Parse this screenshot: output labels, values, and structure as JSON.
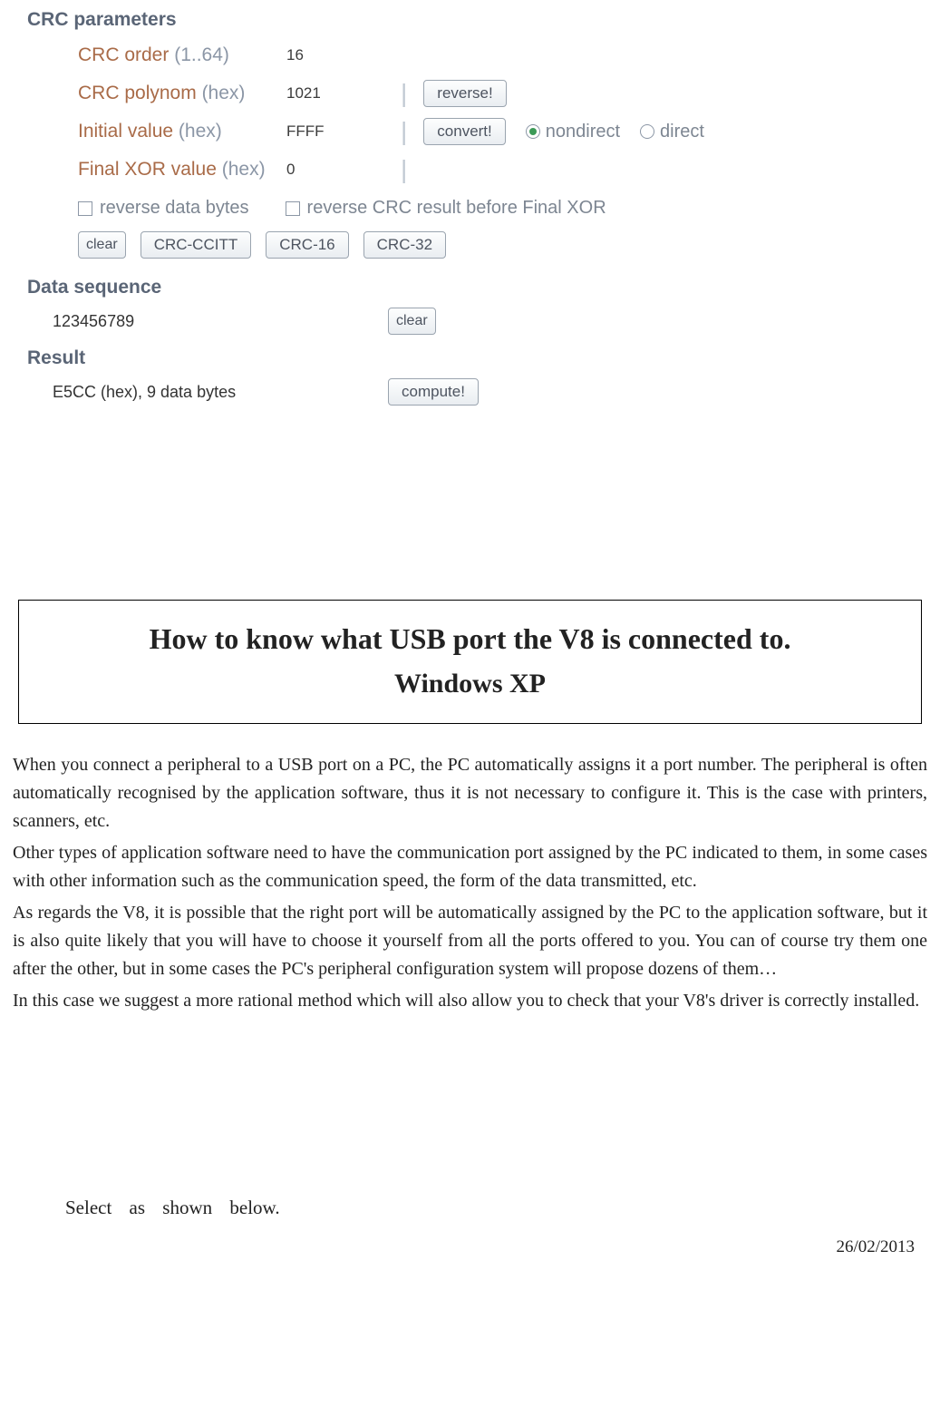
{
  "crc": {
    "parameters_heading": "CRC parameters",
    "order_label": "CRC order",
    "order_hint": "(1..64)",
    "order_value": "16",
    "polynom_label": "CRC polynom",
    "hex_hint": "(hex)",
    "polynom_value": "1021",
    "reverse_btn": "reverse!",
    "initial_label": "Initial value",
    "initial_value": "FFFF",
    "convert_btn": "convert!",
    "radio_nondirect": "nondirect",
    "radio_direct": "direct",
    "final_label": "Final XOR value",
    "final_value": "0",
    "chk_reverse_data": "reverse data bytes",
    "chk_reverse_result": "reverse CRC result before Final XOR",
    "clear_btn": "clear",
    "preset_ccitt": "CRC-CCITT",
    "preset_16": "CRC-16",
    "preset_32": "CRC-32",
    "data_sequence_heading": "Data sequence",
    "data_sequence_value": "123456789",
    "result_heading": "Result",
    "result_value": "E5CC (hex), 9 data bytes",
    "compute_btn": "compute!"
  },
  "doc": {
    "title1": "How to know what USB port the V8 is connected to.",
    "title2": "Windows XP",
    "p1": "When you connect a peripheral to a USB port on a PC, the PC automatically assigns it a port number. The peripheral is often automatically recognised by the application software, thus it is not necessary to configure it. This is the case with printers, scanners, etc.",
    "p2": "Other types of application software need to have the communication port assigned by the PC indicated to them, in some cases with other information such as the communication speed, the form of the data transmitted, etc.",
    "p3": "As regards the V8, it is possible that the right port will be automatically assigned by the PC to the application software, but it is also quite likely that you will have to choose it yourself from all the ports offered to you. You can of course try them one after the other, but in some cases the PC's peripheral configuration system will propose dozens of them…",
    "p4": "In this case we suggest a more rational method which will also allow you to check that your V8's driver is correctly installed.",
    "select_line": "Select as shown below.",
    "date": "26/02/2013"
  }
}
